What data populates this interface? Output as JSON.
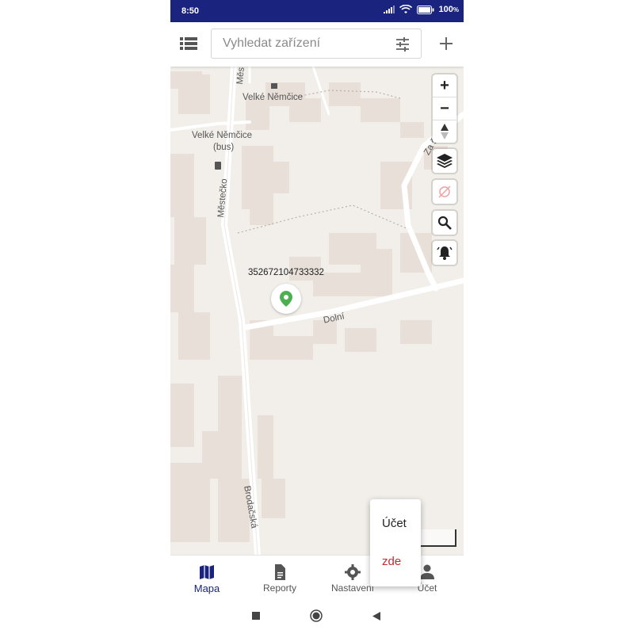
{
  "status_bar": {
    "time": "8:50",
    "battery": "100"
  },
  "search": {
    "placeholder": "Vyhledat zařízení",
    "value": ""
  },
  "map": {
    "labels": {
      "poi_post": "Velké Němčice",
      "bus_stop_line1": "Velké Němčice",
      "bus_stop_line2": "(bus)",
      "street_mestecko": "Městečko",
      "street_mestecko_top": "Měs",
      "street_dolni": "Dolní",
      "street_brodacska": "Brodačská",
      "street_za": "Za š"
    },
    "device": {
      "id": "352672104733332"
    }
  },
  "popup_menu": {
    "items": [
      {
        "label": "Účet"
      },
      {
        "label": "zde"
      }
    ]
  },
  "bottom_nav": {
    "items": [
      {
        "label": "Mapa",
        "icon": "map-icon",
        "active": true
      },
      {
        "label": "Reporty",
        "icon": "document-icon",
        "active": false
      },
      {
        "label": "Nastavení",
        "icon": "gear-icon",
        "active": false
      },
      {
        "label": "Účet",
        "icon": "person-icon",
        "active": false
      }
    ]
  },
  "colors": {
    "status_bar": "#1a237e",
    "accent": "#1a237e",
    "marker": "#4caf50",
    "menu_highlight": "#c62828",
    "map_background": "#f2efea",
    "building": "#e8e0d8",
    "road": "#ffffff"
  }
}
